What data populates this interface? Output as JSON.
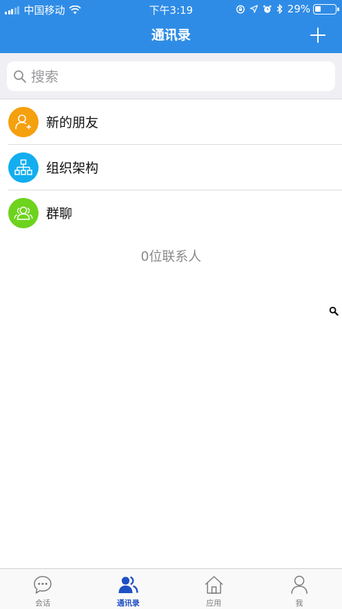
{
  "status_bar": {
    "carrier": "中国移动",
    "time": "下午3:19",
    "battery_percent_label": "29%",
    "battery_level": 0.29
  },
  "nav": {
    "title": "通讯录",
    "add_icon": "plus-icon"
  },
  "search": {
    "placeholder": "搜索",
    "icon": "search-icon"
  },
  "entries": [
    {
      "label": "新的朋友",
      "icon": "add-friend-icon",
      "color": "#f5a00e"
    },
    {
      "label": "组织架构",
      "icon": "org-chart-icon",
      "color": "#12aeef"
    },
    {
      "label": "群聊",
      "icon": "group-icon",
      "color": "#6dd31d"
    }
  ],
  "contact_count": "0位联系人",
  "tabs": [
    {
      "label": "会话",
      "icon": "chat-icon",
      "active": false
    },
    {
      "label": "通讯录",
      "icon": "contacts-icon",
      "active": true
    },
    {
      "label": "应用",
      "icon": "home-app-icon",
      "active": false
    },
    {
      "label": "我",
      "icon": "person-icon",
      "active": false
    }
  ],
  "colors": {
    "header": "#2f8ce6",
    "tab_active": "#1f4fc4",
    "tab_inactive": "#7a7a7a"
  }
}
